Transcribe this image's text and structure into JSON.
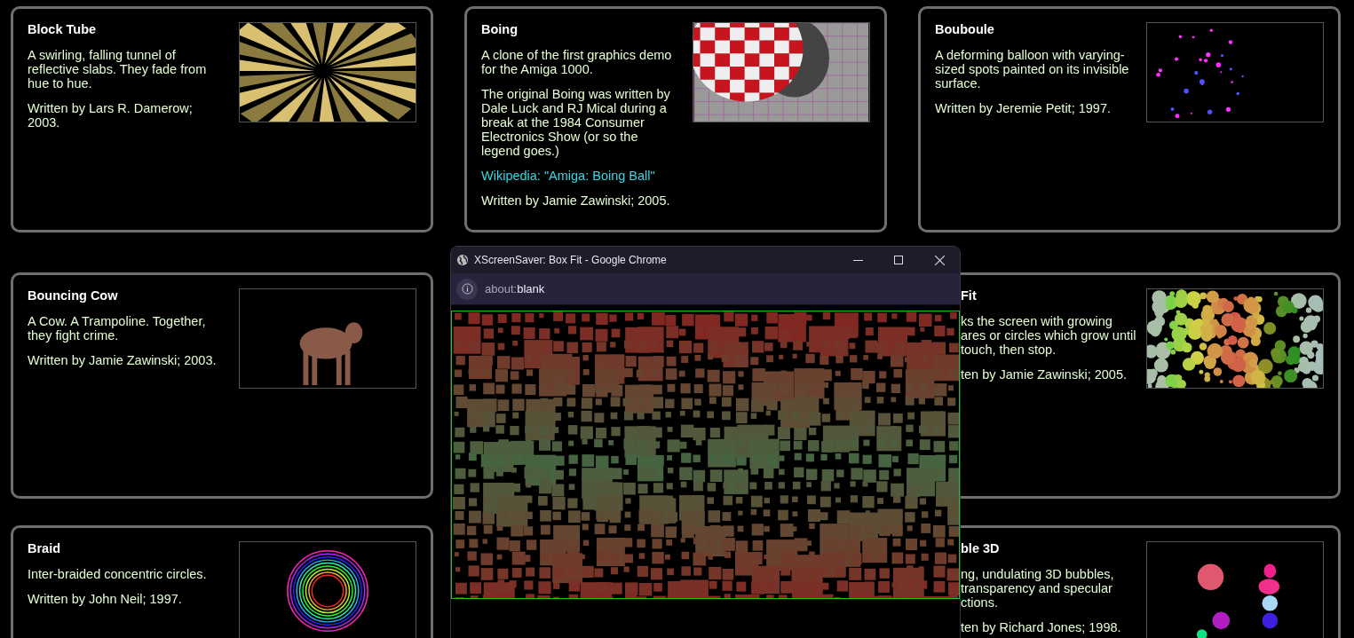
{
  "cards": [
    {
      "title": "Block Tube",
      "clipped": false,
      "preview": {
        "kind": "tunnel"
      },
      "paragraphs": [
        {
          "kind": "text",
          "lines": [
            "A swirling, falling tunnel of reflective slabs. They fade from hue to hue."
          ]
        },
        {
          "kind": "text",
          "lines": [
            "Written by Lars R. Damerow; 2003."
          ]
        }
      ]
    },
    {
      "title": "Boing",
      "clipped": false,
      "preview": {
        "kind": "checkerball"
      },
      "paragraphs": [
        {
          "kind": "text",
          "lines": [
            "A clone of the first graphics demo for the Amiga 1000."
          ]
        },
        {
          "kind": "text",
          "lines": [
            "The original Boing was written by Dale Luck and RJ Mical during a break at the 1984 Consumer Electronics Show (or so the legend goes.)"
          ]
        },
        {
          "kind": "link",
          "lines": [
            "Wikipedia: \"Amiga: Boing Ball\""
          ]
        },
        {
          "kind": "text",
          "lines": [
            "Written by Jamie Zawinski; 2005."
          ]
        }
      ]
    },
    {
      "title": "Bouboule",
      "clipped": false,
      "preview": {
        "kind": "dots"
      },
      "paragraphs": [
        {
          "kind": "text",
          "lines": [
            "A deforming balloon with varying-sized spots painted on its invisible surface."
          ]
        },
        {
          "kind": "text",
          "lines": [
            "Written by Jeremie Petit; 1997."
          ]
        }
      ]
    },
    {
      "title": "Bouncing Cow",
      "clipped": false,
      "preview": {
        "kind": "cow"
      },
      "paragraphs": [
        {
          "kind": "text",
          "lines": [
            "A Cow. A Trampoline. Together, they fight crime."
          ]
        },
        {
          "kind": "text",
          "lines": [
            "Written by Jamie Zawinski; 2003."
          ]
        }
      ]
    },
    {
      "title": "Fit",
      "clipped": true,
      "preview": {
        "kind": "circles"
      },
      "paragraphs": [
        {
          "kind": "text",
          "lines": [
            "ks the screen with growing",
            "ares or circles which grow until",
            "touch, then stop."
          ]
        },
        {
          "kind": "text",
          "lines": [
            "ten by Jamie Zawinski; 2005."
          ]
        }
      ]
    },
    {
      "title": "Braid",
      "clipped": false,
      "preview": {
        "kind": "rings"
      },
      "paragraphs": [
        {
          "kind": "text",
          "lines": [
            "Inter-braided concentric circles."
          ]
        },
        {
          "kind": "text",
          "lines": [
            "Written by John Neil; 1997."
          ]
        }
      ]
    },
    {
      "title": "ble 3D",
      "clipped": true,
      "preview": {
        "kind": "bubbles"
      },
      "paragraphs": [
        {
          "kind": "text",
          "lines": [
            "ng, undulating 3D bubbles,",
            "transparency and specular",
            "ctions."
          ]
        },
        {
          "kind": "text",
          "lines": [
            "ten by Richard Jones; 1998."
          ]
        }
      ]
    }
  ],
  "window": {
    "title": "XScreenSaver: Box Fit - Google Chrome",
    "address": {
      "scheme": "about:",
      "path": "blank"
    }
  }
}
